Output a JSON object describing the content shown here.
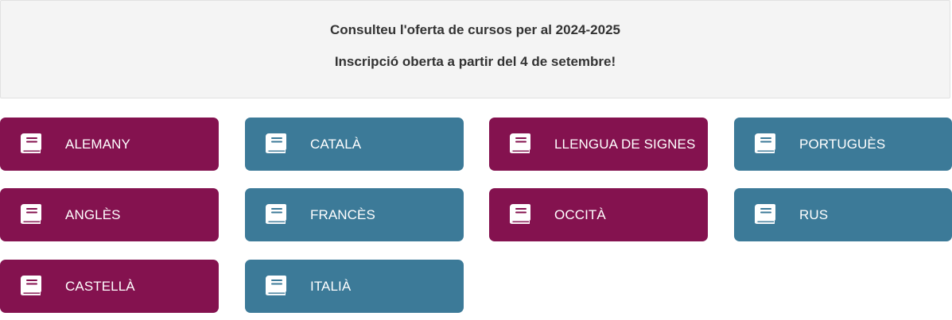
{
  "notice": {
    "line1": "Consulteu l'oferta de cursos per al 2024-2025",
    "line2": "Inscripció oberta a partir del 4 de setembre!"
  },
  "colors": {
    "purple": "#84124f",
    "teal": "#3c7a98"
  },
  "courses": [
    {
      "label": "ALEMANY",
      "color": "purple",
      "icon": "book-icon"
    },
    {
      "label": "CATALÀ",
      "color": "teal",
      "icon": "book-icon"
    },
    {
      "label": "LLENGUA DE SIGNES",
      "color": "purple",
      "icon": "book-icon"
    },
    {
      "label": "PORTUGUÈS",
      "color": "teal",
      "icon": "book-icon"
    },
    {
      "label": "ANGLÈS",
      "color": "purple",
      "icon": "book-icon"
    },
    {
      "label": "FRANCÈS",
      "color": "teal",
      "icon": "book-icon"
    },
    {
      "label": "OCCITÀ",
      "color": "purple",
      "icon": "book-icon"
    },
    {
      "label": "RUS",
      "color": "teal",
      "icon": "book-icon"
    },
    {
      "label": "CASTELLÀ",
      "color": "purple",
      "icon": "book-icon"
    },
    {
      "label": "ITALIÀ",
      "color": "teal",
      "icon": "book-icon"
    }
  ]
}
